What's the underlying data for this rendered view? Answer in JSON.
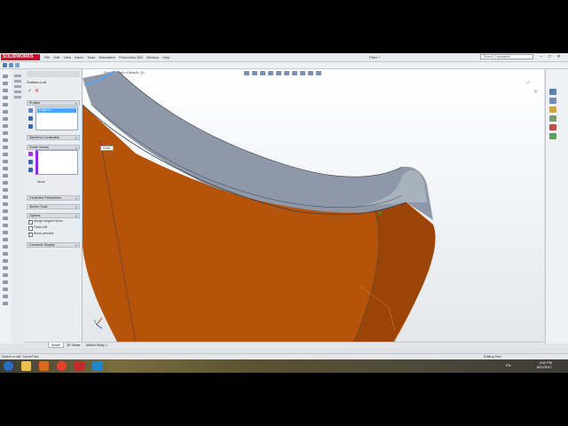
{
  "app": {
    "logo": "SOLIDWORKS",
    "menus": [
      "File",
      "Edit",
      "View",
      "Insert",
      "Tools",
      "Simulation",
      "PhotoView 360",
      "Window",
      "Help"
    ],
    "document_title": "Part1 *",
    "search_placeholder": "Search Commands",
    "window_buttons": [
      "–",
      "□",
      "✕"
    ]
  },
  "property_manager": {
    "title": "Surface-Loft",
    "ok": "✓",
    "cancel": "✕",
    "sections": {
      "profiles": "Profiles",
      "profile_item": "Edge<1>",
      "start_end": "Start/End Constraints",
      "guide_curves": "Guide Curves",
      "guide_none": "None",
      "centerline": "Centerline Parameters",
      "sketch_tools": "Sketch Tools",
      "options": "Options",
      "merge": "Merge tangent faces",
      "close_loft": "Close loft",
      "show_preview": "Show preview",
      "curvature": "Curvature Display"
    }
  },
  "viewport": {
    "breadcrumb": "Part1 (Default<<Default>_Di...",
    "callout": "Profile",
    "colors": {
      "face": "#b45309",
      "top_surface": "#8e98a8",
      "edge": "#3a3f47",
      "highlight": "#4da3ff"
    }
  },
  "bottom_tabs": [
    "Model",
    "3D Views",
    "Motion Study 1"
  ],
  "status": {
    "left": "Select or loft. Curve/Flex",
    "right": "Editing Part"
  },
  "taskbar": {
    "lang": "EN",
    "time": "3:02 PM",
    "date": "6/21/2017"
  }
}
